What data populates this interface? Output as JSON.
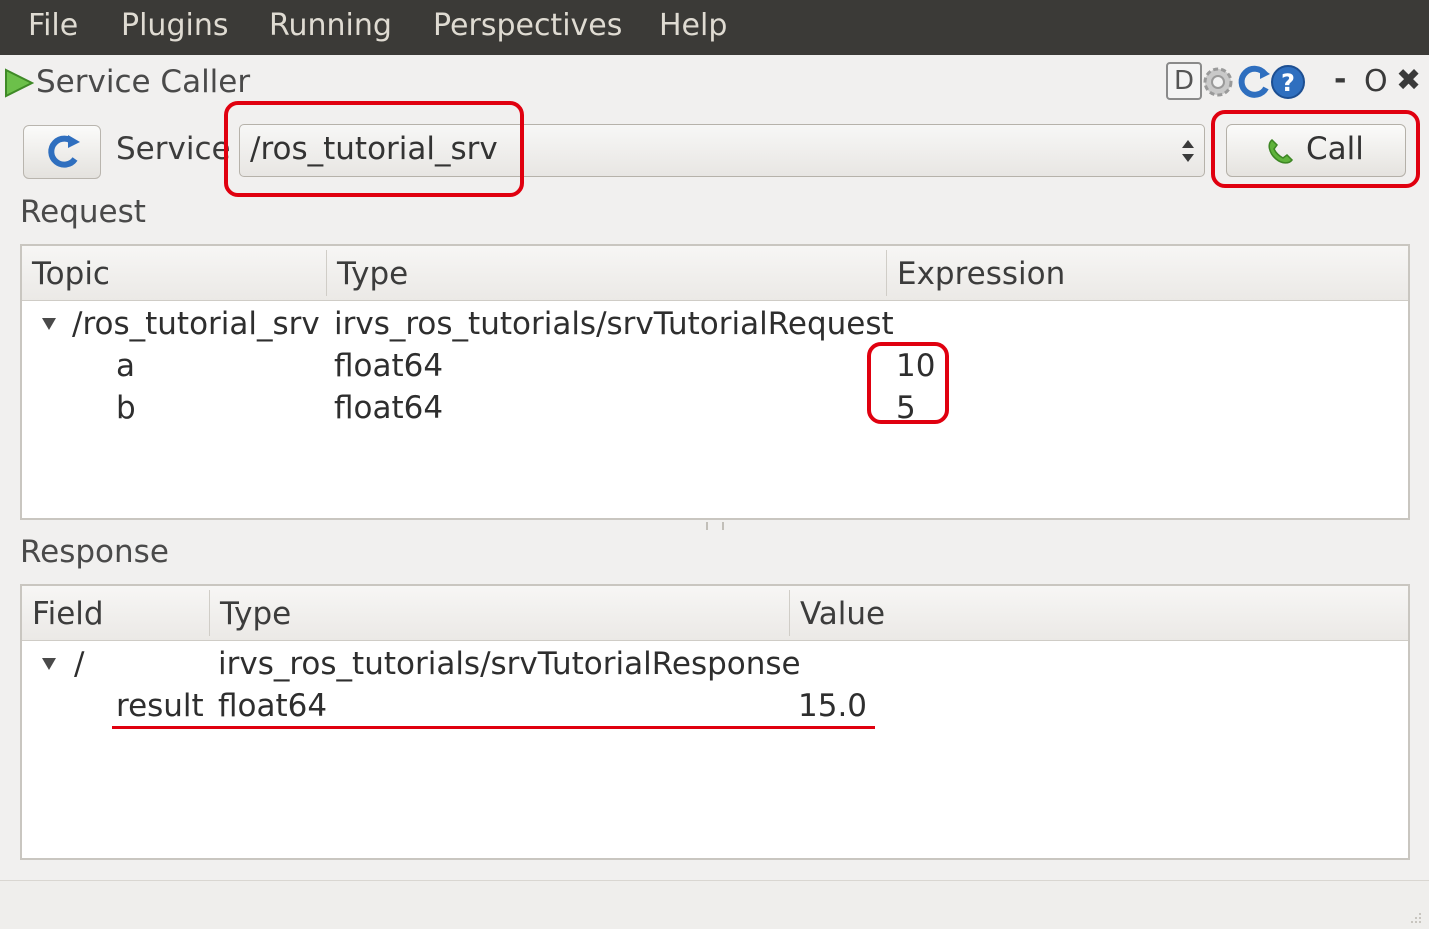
{
  "menu": {
    "file": "File",
    "plugins": "Plugins",
    "running": "Running",
    "perspectives": "Perspectives",
    "help": "Help"
  },
  "plugin": {
    "title": "Service Caller",
    "icon": "play-icon",
    "controls": {
      "d_label": "D",
      "minimize": "-",
      "restore": "O",
      "close": "✖"
    }
  },
  "service_row": {
    "label": "Service",
    "value": "/ros_tutorial_srv",
    "call_label": "Call"
  },
  "request": {
    "label": "Request",
    "columns": [
      "Topic",
      "Type",
      "Expression"
    ],
    "rows": [
      {
        "topic": "/ros_tutorial_srv",
        "type": "irvs_ros_tutorials/srvTutorialRequest",
        "expression": ""
      },
      {
        "topic": "a",
        "type": "float64",
        "expression": "10"
      },
      {
        "topic": "b",
        "type": "float64",
        "expression": "5"
      }
    ]
  },
  "response": {
    "label": "Response",
    "columns": [
      "Field",
      "Type",
      "Value"
    ],
    "rows": [
      {
        "field": "/",
        "type": "irvs_ros_tutorials/srvTutorialResponse",
        "value": ""
      },
      {
        "field": "result",
        "type": "float64",
        "value": "15.0"
      }
    ]
  },
  "colors": {
    "menubar_bg": "#3b3a37",
    "annotation_red": "#e0000f",
    "play_green": "#6cc04a"
  }
}
